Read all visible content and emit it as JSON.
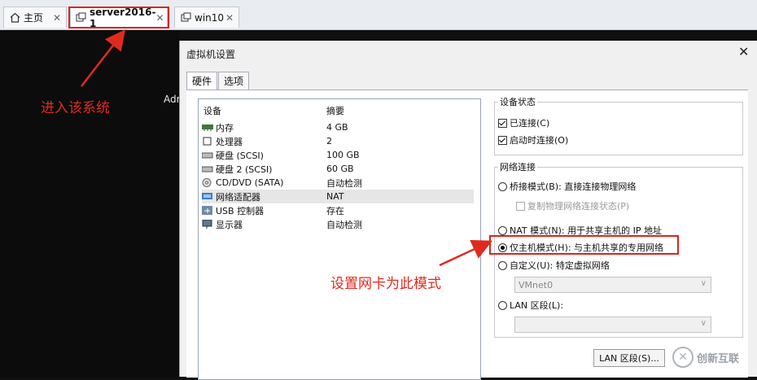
{
  "tabs": [
    {
      "label": "主页",
      "icon": "home-icon"
    },
    {
      "label": "server2016-1",
      "icon": "vm-icon"
    },
    {
      "label": "win10",
      "icon": "vm-icon"
    }
  ],
  "tab_close": "✕",
  "background_text": "Adr",
  "dialog": {
    "title": "虚拟机设置",
    "close": "✕",
    "tabs": [
      "硬件",
      "选项"
    ]
  },
  "device_list": {
    "col_device": "设备",
    "col_summary": "摘要",
    "rows": [
      {
        "name": "内存",
        "summary": "4 GB",
        "icon": "memory-icon"
      },
      {
        "name": "处理器",
        "summary": "2",
        "icon": "cpu-icon"
      },
      {
        "name": "硬盘 (SCSI)",
        "summary": "100 GB",
        "icon": "disk-icon"
      },
      {
        "name": "硬盘 2 (SCSI)",
        "summary": "60 GB",
        "icon": "disk-icon"
      },
      {
        "name": "CD/DVD (SATA)",
        "summary": "自动检测",
        "icon": "cd-icon"
      },
      {
        "name": "网络适配器",
        "summary": "NAT",
        "icon": "network-icon",
        "selected": true
      },
      {
        "name": "USB 控制器",
        "summary": "存在",
        "icon": "usb-icon"
      },
      {
        "name": "显示器",
        "summary": "自动检测",
        "icon": "display-icon"
      }
    ]
  },
  "device_status": {
    "legend": "设备状态",
    "connected": "已连接(C)",
    "connect_on_power": "启动时连接(O)"
  },
  "network": {
    "legend": "网络连接",
    "bridged": "桥接模式(B): 直接连接物理网络",
    "replicate": "复制物理网络连接状态(P)",
    "nat": "NAT 模式(N): 用于共享主机的 IP 地址",
    "hostonly": "仅主机模式(H): 与主机共享的专用网络",
    "custom": "自定义(U): 特定虚拟网络",
    "custom_value": "VMnet0",
    "lan": "LAN 区段(L):",
    "lan_value": ""
  },
  "lan_button": "LAN 区段(S)...",
  "annotations": {
    "enter_system": "进入该系统",
    "set_nic": "设置网卡为此模式"
  },
  "watermark": "创新互联",
  "colors": {
    "annotation": "#e02a1e",
    "highlight": "#d9261c"
  }
}
